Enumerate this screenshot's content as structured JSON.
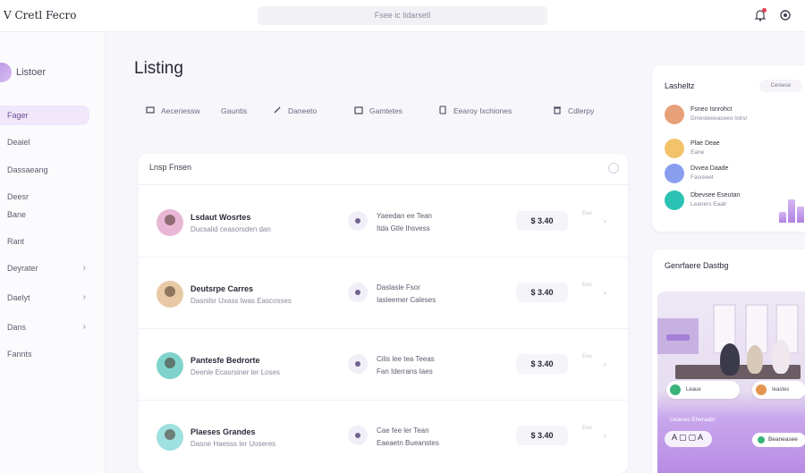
{
  "app": {
    "brand": "V Cretl Fecro"
  },
  "search": {
    "placeholder": "Fsee ic lidarsetl"
  },
  "sidebar": {
    "title": "Listoer",
    "items": [
      {
        "label": "Fager",
        "active": true,
        "has_chevron": false
      },
      {
        "label": "Deaiel",
        "active": false,
        "has_chevron": false
      },
      {
        "label": "Dassaeang",
        "active": false,
        "has_chevron": false
      },
      {
        "label": "Deesr",
        "active": false,
        "has_chevron": false
      },
      {
        "label": "Bane",
        "active": false,
        "has_chevron": false
      },
      {
        "label": "Rant",
        "active": false,
        "has_chevron": false
      },
      {
        "label": "Deyrater",
        "active": false,
        "has_chevron": true
      },
      {
        "label": "Daelyt",
        "active": false,
        "has_chevron": true
      },
      {
        "label": "Dans",
        "active": false,
        "has_chevron": true
      },
      {
        "label": "Fannts",
        "active": false,
        "has_chevron": false
      }
    ]
  },
  "main": {
    "title": "Listing",
    "tabs": [
      {
        "label": "Aeceriessw",
        "icon": "grid-icon"
      },
      {
        "label": "Gauntis",
        "icon": "none"
      },
      {
        "label": "Daneeto",
        "icon": "edit-icon"
      },
      {
        "label": "Gamtetes",
        "icon": "folder-icon"
      },
      {
        "label": "Eearoy Ixchiones",
        "icon": "book-icon"
      },
      {
        "label": "Cdlerpy",
        "icon": "trash-icon"
      }
    ],
    "list": {
      "heading": "Lnsp Fnsen",
      "rows": [
        {
          "name": "Lsdaut Wosrtes",
          "subtitle": "Ducsalid ceasorsden dan",
          "detail1": "Yaeedan ee Tean",
          "detail2": "Itda Gtle Ihsvess",
          "price": "$ 3.40",
          "meta": "Eeo",
          "avatar_color": "#e9b7d6"
        },
        {
          "name": "Deutsrpe Carres",
          "subtitle": "Dasnilsr Uxass Iwas Eascosses",
          "detail1": "Daslasle Fsor",
          "detail2": "Iasleemer Caleses",
          "price": "$ 3.40",
          "meta": "Eeo",
          "avatar_color": "#e8c9a6"
        },
        {
          "name": "Pantesfe Bedrorte",
          "subtitle": "Deenle Ecasrsiner ler Loses",
          "detail1": "Cilis lee tea Teeas",
          "detail2": "Fan Iderrans Iaes",
          "price": "$ 3.40",
          "meta": "Eeo",
          "avatar_color": "#7fd3cc"
        },
        {
          "name": "Plaeses Grandes",
          "subtitle": "Dasne Haesss ler Uoseres",
          "detail1": "Cae fee ler Tean",
          "detail2": "Eaeaetn Bueanstes",
          "price": "$ 3.40",
          "meta": "Eeo",
          "avatar_color": "#9fe0e0"
        }
      ]
    }
  },
  "analytics": {
    "title": "Lasheltz",
    "filter": "Cereese",
    "entries": [
      {
        "line1": "Fsneo Isnrohct",
        "line2": "Dmesteeeaceeo Iolrsr",
        "color": "#e7a07a"
      },
      {
        "line1": "Plae Deae",
        "line2": "Eane",
        "color": "#f3c36b"
      },
      {
        "line1": "Dvvea Daade",
        "line2": "Fasreeet",
        "color": "#8a9ef0"
      },
      {
        "line1": "Dbevsee Eseutan",
        "line2": "Leaners Eaalr",
        "color": "#2cc3b5"
      }
    ],
    "bars": [
      0.45,
      1.0,
      0.7
    ]
  },
  "gallery": {
    "title": "Genrfaere Dastbg",
    "chip_left": "Leaue",
    "chip_right": "Ieastes",
    "footer_label": "Ueanes Eheraatn",
    "icons": "A▢▢A",
    "action": "Beaneasee"
  },
  "colors": {
    "accent": "#b083e0",
    "active_bg": "#f1e7fb",
    "teal": "#2cc3b5"
  }
}
